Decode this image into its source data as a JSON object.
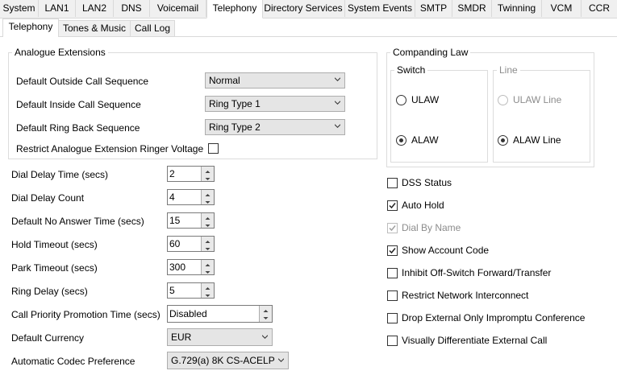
{
  "top_tabs": [
    "System",
    "LAN1",
    "LAN2",
    "DNS",
    "Voicemail",
    "Telephony",
    "Directory Services",
    "System Events",
    "SMTP",
    "SMDR",
    "Twinning",
    "VCM",
    "CCR"
  ],
  "sub_tabs": [
    "Telephony",
    "Tones & Music",
    "Call Log"
  ],
  "analogue": {
    "legend": "Analogue Extensions",
    "outside_label": "Default Outside Call Sequence",
    "outside_value": "Normal",
    "inside_label": "Default Inside Call Sequence",
    "inside_value": "Ring Type 1",
    "ringback_label": "Default Ring Back Sequence",
    "ringback_value": "Ring Type 2",
    "restrict_label": "Restrict Analogue Extension Ringer Voltage"
  },
  "fields": {
    "dial_delay_time_label": "Dial Delay Time (secs)",
    "dial_delay_time": "2",
    "dial_delay_count_label": "Dial Delay Count",
    "dial_delay_count": "4",
    "no_answer_label": "Default No Answer Time (secs)",
    "no_answer": "15",
    "hold_timeout_label": "Hold Timeout (secs)",
    "hold_timeout": "60",
    "park_timeout_label": "Park Timeout (secs)",
    "park_timeout": "300",
    "ring_delay_label": "Ring Delay (secs)",
    "ring_delay": "5",
    "priority_label": "Call Priority Promotion Time (secs)",
    "priority": "Disabled",
    "currency_label": "Default Currency",
    "currency": "EUR",
    "codec_label": "Automatic Codec Preference",
    "codec": "G.729(a) 8K CS-ACELP"
  },
  "companding": {
    "legend": "Companding Law",
    "switch_legend": "Switch",
    "line_legend": "Line",
    "switch_ulaw": "ULAW",
    "switch_alaw": "ALAW",
    "line_ulaw": "ULAW Line",
    "line_alaw": "ALAW Line"
  },
  "options": {
    "dss_status": "DSS Status",
    "auto_hold": "Auto Hold",
    "dial_by_name": "Dial By Name",
    "show_account_code": "Show Account Code",
    "inhibit_offswitch": "Inhibit Off-Switch Forward/Transfer",
    "restrict_network": "Restrict Network Interconnect",
    "drop_external": "Drop External Only Impromptu Conference",
    "visually_diff": "Visually Differentiate External Call"
  }
}
